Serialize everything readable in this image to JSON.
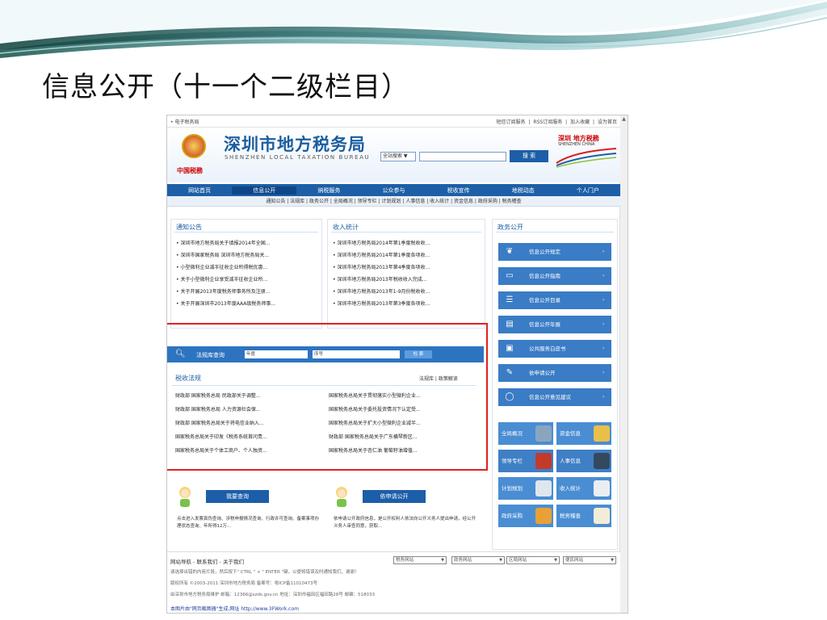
{
  "slide": {
    "title": "信息公开（十一个二级栏目）"
  },
  "site": {
    "topbar_left": "• 电子税务局",
    "topbar_links": [
      "短信订阅服务",
      "|",
      "RSS订阅服务",
      "|",
      "加入收藏",
      "|",
      "设为首页"
    ],
    "title": "深圳市地方税务局",
    "subtitle": "SHENZHEN LOCAL TAXATION BUREAU",
    "cn_tax": "中国税務",
    "search_select": "全站搜索",
    "search_button": "搜 索",
    "logo_right_title": "深圳 地方税務",
    "logo_right_sub": "SHENZHEN CHINA",
    "nav": [
      "网站首页",
      "信息公开",
      "纳税服务",
      "公众参与",
      "税收宣传",
      "地税动态",
      "个人门户"
    ],
    "subnav": "通知公告 | 法规库 | 政务公开 | 全局概况 | 领导专栏 | 计划规划 | 人事信息 | 收入统计 | 资金信息 | 政府采购 | 税务稽查"
  },
  "notice": {
    "title": "通知公告",
    "items": [
      "• 深圳市地方税务局关于填报2014年全国...",
      "• 深圳市国家税务局 深圳市地方税务局关...",
      "• 小型微利企业减半征收企业所得税优惠...",
      "• 关于小型微利企业享受减半征收企业所...",
      "• 关于开展2013年度税务师事务所及注册...",
      "• 关于开展深圳市2013年度AAA级税务师事..."
    ]
  },
  "income": {
    "title": "收入统计",
    "items": [
      "• 深圳市地方税务局2014年第1季度税收收...",
      "• 深圳市地方税务局2014年第1季度各项收...",
      "• 深圳市地方税务局2013年第4季度各项收...",
      "• 深圳市地方税务局2013年税收收入完成...",
      "• 深圳市地方税务局2013年1-9月份税收收...",
      "• 深圳市地方税务局2013年第3季度各项收..."
    ]
  },
  "gov": {
    "title": "政务公开",
    "buttons": [
      "信息公开规定",
      "信息公开指南",
      "信息公开目录",
      "信息公开年报",
      "公共服务白皮书",
      "依申请公开",
      "信息公开意见建议"
    ],
    "arrow": "»"
  },
  "law_search": {
    "label": "法规库查询",
    "year_placeholder": "年度",
    "number_placeholder": "序号",
    "button": "检 索"
  },
  "law": {
    "title": "税收法规",
    "tabs": "法规库 | 政策解读",
    "rows": [
      [
        "财政部 国家税务总局 民政部关于调整...",
        "国家税务总局关于贯彻落实小型微利企业..."
      ],
      [
        "财政部 国家税务总局 人力资源社会保...",
        "国家税务总局关于委托投资情况下认定受..."
      ],
      [
        "财政部 国家税务总局关于将电信业纳入...",
        "国家税务总局关于扩大小型微利企业减半..."
      ],
      [
        "国家税务总局关于印发《税务系统首问责...",
        "财政部 国家税务总局关于广东横琴新区..."
      ],
      [
        "国家税务总局关于个体工商户、个人独资...",
        "国家税务总局关于杏仁油 葡萄籽油增值..."
      ]
    ]
  },
  "tiles": [
    "全局概况",
    "资金信息",
    "领导专栏",
    "人事信息",
    "计划规划",
    "收入统计",
    "政府采购",
    "税务稽查"
  ],
  "cards": {
    "left_button": "我要查询",
    "left_text": "点击进入发票真伪查询、涉税申报情况查询、行政许可查询、备案事项办理状态查询、年所得12万...",
    "right_button": "依申请公开",
    "right_text": "依申请公开政府信息，是公开权利人依法向公开义务人提出申请，经公开义务人审查同意，获取..."
  },
  "footer": {
    "nav": "网站导航 - 联系我们 - 关于我们",
    "selects": [
      "税务网站",
      "政务网站",
      "区局网站",
      "便民网站"
    ],
    "line1": "请选择出错的内容片段，然后按下\" CTRL \" + \" ENTER \"键，以便将错误及时通知我们，谢谢！",
    "line2": "版权所有 ©2003-2011 深圳市地方税务局 备案号：粤ICP备11010473号",
    "line3": "由深圳市地方税务局维护 邮箱：12366@szds.gov.cn 地址：深圳市福田区福田路28号 邮编：518033",
    "credit": "本图片由\"网页截图器\"生成,网址 http://www.3FWork.com"
  },
  "colors": {
    "nav": "#1d5fa7",
    "accent": "#3a7cc5",
    "highlight_box": "#e02020"
  }
}
